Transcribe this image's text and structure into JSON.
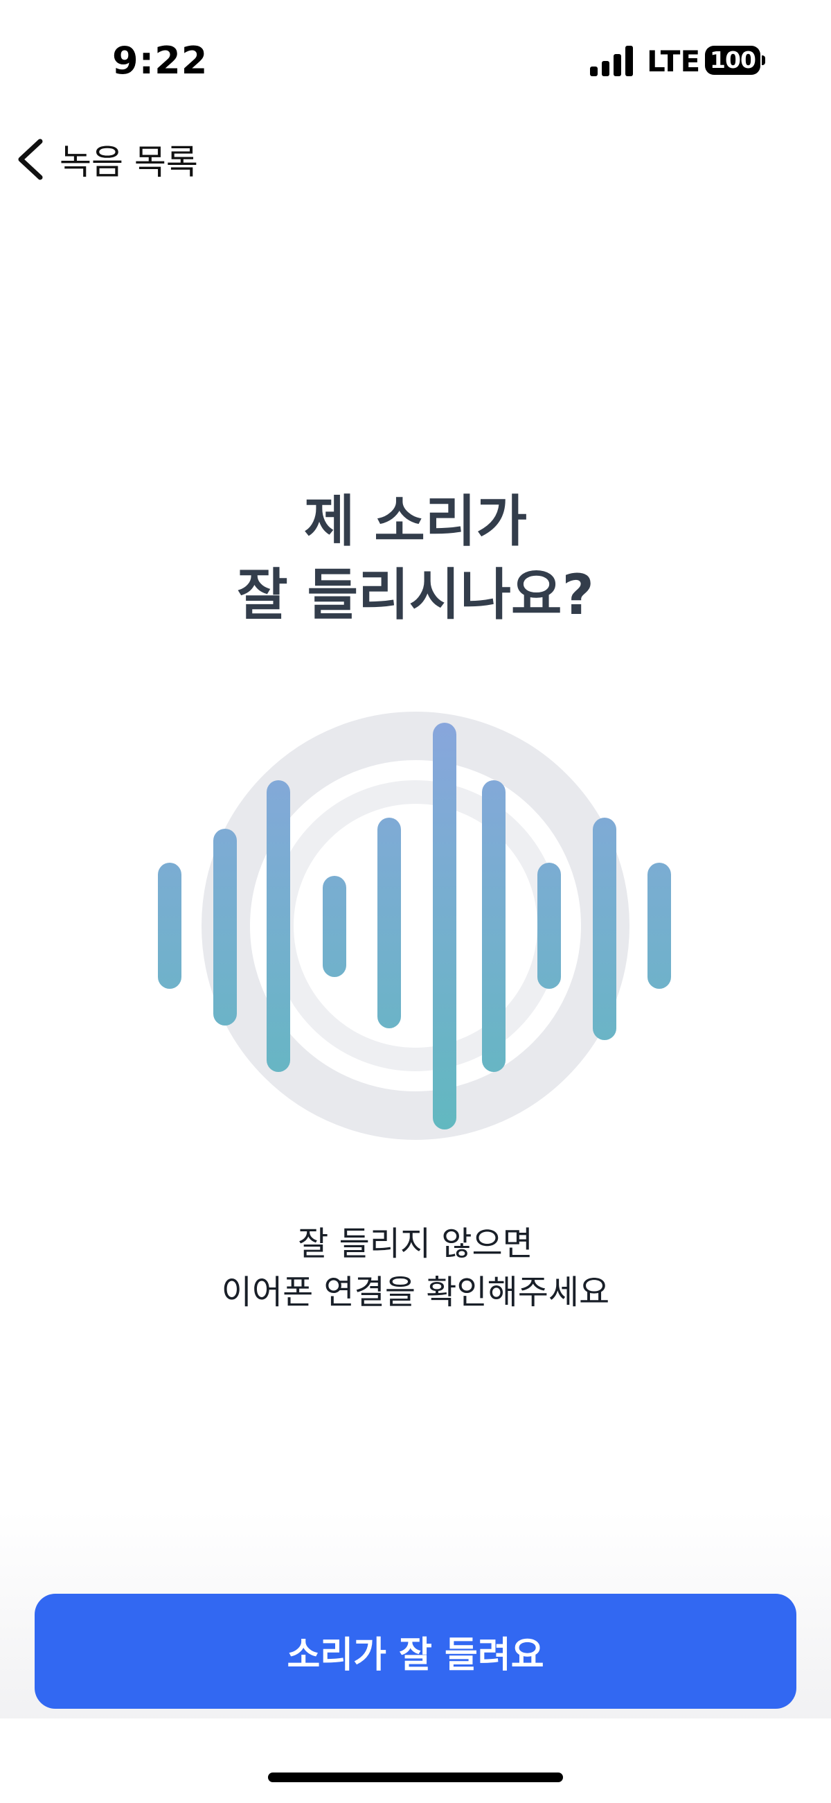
{
  "status_bar": {
    "time": "9:22",
    "network": "LTE",
    "battery": "100"
  },
  "nav": {
    "back_label": "녹음 목록",
    "back_icon": "chevron-left-icon"
  },
  "main": {
    "title_line1": "제 소리가",
    "title_line2": "잘 들리시나요?",
    "subtitle_line1": "잘 들리지 않으면",
    "subtitle_line2": "이어폰 연결을 확인해주세요",
    "visual_icon": "sound-wave-icon"
  },
  "footer": {
    "confirm_label": "소리가 잘 들려요"
  },
  "colors": {
    "primary": "#3268f2",
    "title": "#333d4b",
    "wave_top": "#88a6dc",
    "wave_bottom": "#62b8c0",
    "ring": "#e8e9ed"
  }
}
